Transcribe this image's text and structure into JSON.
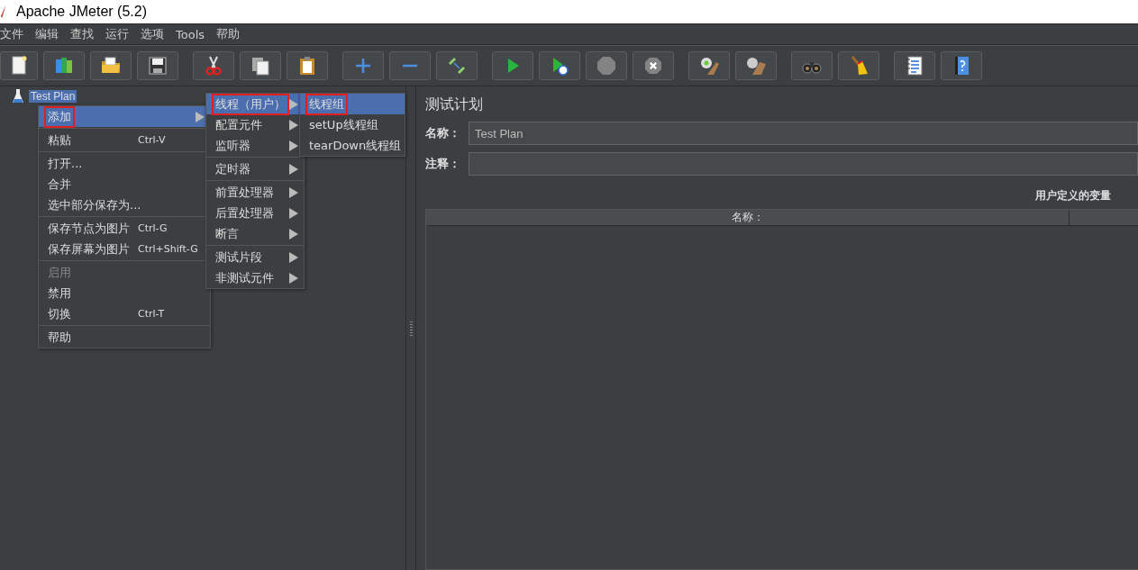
{
  "window": {
    "title": "Apache JMeter (5.2)"
  },
  "menubar": [
    {
      "label": "文件"
    },
    {
      "label": "编辑"
    },
    {
      "label": "查找"
    },
    {
      "label": "运行"
    },
    {
      "label": "选项"
    },
    {
      "label": "Tools"
    },
    {
      "label": "帮助"
    }
  ],
  "toolbar_groups": [
    [
      {
        "disabled": false
      },
      {
        "disabled": false
      },
      {
        "disabled": false
      },
      {
        "disabled": false
      }
    ],
    [
      {
        "disabled": false
      },
      {
        "disabled": false
      },
      {
        "disabled": false
      }
    ],
    [
      {
        "disabled": false
      },
      {
        "disabled": false
      },
      {
        "disabled": false
      }
    ],
    [
      {
        "disabled": false
      },
      {
        "disabled": false
      },
      {
        "disabled": true
      },
      {
        "disabled": true
      }
    ],
    [
      {
        "disabled": false
      },
      {
        "disabled": false
      }
    ],
    [
      {
        "disabled": false
      },
      {
        "disabled": false
      }
    ],
    [
      {
        "disabled": false
      },
      {
        "disabled": false
      }
    ]
  ],
  "tree": [
    {
      "label": "Test Plan",
      "selected": true
    }
  ],
  "context_menu": [
    {
      "kind": "item",
      "label": "添加",
      "submenu": true,
      "selected": true,
      "marked": true,
      "disabled": false
    },
    {
      "kind": "separator"
    },
    {
      "kind": "item",
      "label": "粘贴",
      "shortcut": "Ctrl-V",
      "submenu": false,
      "selected": false,
      "marked": false,
      "disabled": false
    },
    {
      "kind": "separator"
    },
    {
      "kind": "item",
      "label": "打开...",
      "submenu": false,
      "selected": false,
      "marked": false,
      "disabled": false
    },
    {
      "kind": "item",
      "label": "合并",
      "submenu": false,
      "selected": false,
      "marked": false,
      "disabled": false
    },
    {
      "kind": "item",
      "label": "选中部分保存为...",
      "submenu": false,
      "selected": false,
      "marked": false,
      "disabled": false
    },
    {
      "kind": "separator"
    },
    {
      "kind": "item",
      "label": "保存节点为图片",
      "shortcut": "Ctrl-G",
      "submenu": false,
      "selected": false,
      "marked": false,
      "disabled": false
    },
    {
      "kind": "item",
      "label": "保存屏幕为图片",
      "shortcut": "Ctrl+Shift-G",
      "submenu": false,
      "selected": false,
      "marked": false,
      "disabled": false
    },
    {
      "kind": "separator"
    },
    {
      "kind": "item",
      "label": "启用",
      "submenu": false,
      "selected": false,
      "marked": false,
      "disabled": true
    },
    {
      "kind": "item",
      "label": "禁用",
      "submenu": false,
      "selected": false,
      "marked": false,
      "disabled": false
    },
    {
      "kind": "item",
      "label": "切换",
      "shortcut": "Ctrl-T",
      "submenu": false,
      "selected": false,
      "marked": false,
      "disabled": false
    },
    {
      "kind": "separator"
    },
    {
      "kind": "item",
      "label": "帮助",
      "submenu": false,
      "selected": false,
      "marked": false,
      "disabled": false
    }
  ],
  "add_submenu": [
    {
      "kind": "item",
      "label": "线程（用户）",
      "submenu": true,
      "selected": true,
      "marked": true,
      "disabled": false
    },
    {
      "kind": "item",
      "label": "配置元件",
      "submenu": true,
      "selected": false,
      "marked": false,
      "disabled": false
    },
    {
      "kind": "item",
      "label": "监听器",
      "submenu": true,
      "selected": false,
      "marked": false,
      "disabled": false
    },
    {
      "kind": "separator"
    },
    {
      "kind": "item",
      "label": "定时器",
      "submenu": true,
      "selected": false,
      "marked": false,
      "disabled": false
    },
    {
      "kind": "separator"
    },
    {
      "kind": "item",
      "label": "前置处理器",
      "submenu": true,
      "selected": false,
      "marked": false,
      "disabled": false
    },
    {
      "kind": "item",
      "label": "后置处理器",
      "submenu": true,
      "selected": false,
      "marked": false,
      "disabled": false
    },
    {
      "kind": "item",
      "label": "断言",
      "submenu": true,
      "selected": false,
      "marked": false,
      "disabled": false
    },
    {
      "kind": "separator"
    },
    {
      "kind": "item",
      "label": "测试片段",
      "submenu": true,
      "selected": false,
      "marked": false,
      "disabled": false
    },
    {
      "kind": "item",
      "label": "非测试元件",
      "submenu": true,
      "selected": false,
      "marked": false,
      "disabled": false
    }
  ],
  "threads_submenu": [
    {
      "kind": "item",
      "label": "线程组",
      "submenu": false,
      "selected": true,
      "marked": true,
      "disabled": false
    },
    {
      "kind": "item",
      "label": "setUp线程组",
      "submenu": false,
      "selected": false,
      "marked": false,
      "disabled": false
    },
    {
      "kind": "item",
      "label": "tearDown线程组",
      "submenu": false,
      "selected": false,
      "marked": false,
      "disabled": false
    }
  ],
  "panel": {
    "title": "测试计划",
    "fields": [
      {
        "label": "名称：",
        "value": "Test Plan"
      },
      {
        "label": "注释："
      }
    ],
    "variables_label": "用户定义的变量",
    "table": {
      "columns": [
        "名称："
      ]
    }
  }
}
